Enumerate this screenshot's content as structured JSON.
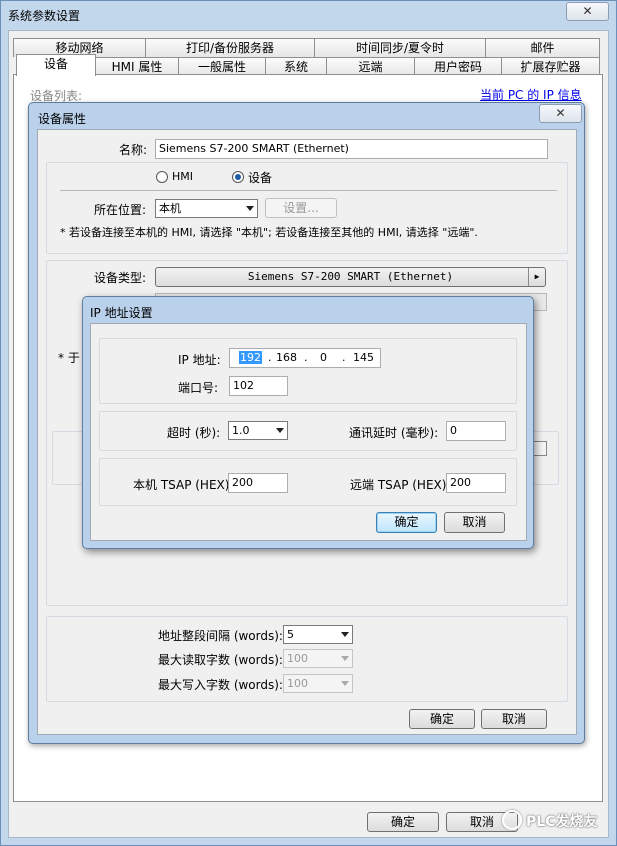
{
  "window": {
    "title": "系统参数设置"
  },
  "tabs_row1": [
    "移动网络",
    "打印/备份服务器",
    "时间同步/夏令时",
    "邮件"
  ],
  "tabs_row2": [
    "设备",
    "HMI 属性",
    "一般属性",
    "系统",
    "远端",
    "用户密码",
    "扩展存贮器"
  ],
  "device_list_label": "设备列表:",
  "ip_info_link": "当前 PC 的 IP 信息",
  "device_dialog": {
    "title": "设备属性",
    "name_label": "名称:",
    "name_value": "Siemens S7-200 SMART (Ethernet)",
    "radio_hmi": "HMI",
    "radio_device": "设备",
    "location_label": "所在位置:",
    "location_value": "本机",
    "settings_button": "设置...",
    "location_note": "* 若设备连接至本机的 HMI, 请选择 \"本机\"; 若设备连接至其他的 HMI, 请选择 \"远端\".",
    "device_type_label": "设备类型:",
    "device_type_value": "Siemens S7-200 SMART (Ethernet)",
    "partial_left": "* 于",
    "addr_interval_label": "地址整段间隔 (words):",
    "addr_interval_value": "5",
    "max_read_label": "最大读取字数 (words):",
    "max_read_value": "100",
    "max_write_label": "最大写入字数 (words):",
    "max_write_value": "100",
    "ok": "确定",
    "cancel": "取消"
  },
  "ip_dialog": {
    "title": "IP 地址设置",
    "ip_label": "IP 地址:",
    "ip1": "192",
    "ip2": "168",
    "ip3": "0",
    "ip4": "145",
    "dot": ".",
    "port_label": "端口号:",
    "port_value": "102",
    "timeout_label": "超时 (秒):",
    "timeout_value": "1.0",
    "delay_label": "通讯延时 (毫秒):",
    "delay_value": "0",
    "local_tsap_label": "本机 TSAP (HEX):",
    "local_tsap_value": "200",
    "remote_tsap_label": "远端 TSAP (HEX):",
    "remote_tsap_value": "200",
    "ok": "确定",
    "cancel": "取消"
  },
  "outer_buttons": {
    "ok": "确定",
    "cancel": "取消"
  },
  "watermark": "PLC发烧友"
}
